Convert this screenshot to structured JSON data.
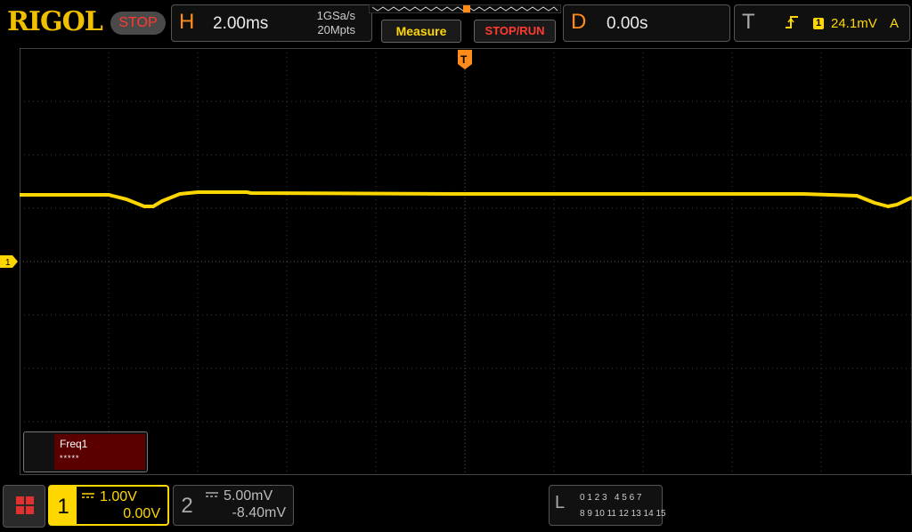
{
  "header": {
    "logo": "RIGOL",
    "run_state": "STOP",
    "horizontal": {
      "label": "H",
      "timebase": "2.00ms",
      "sample_rate": "1GSa/s",
      "memory_depth": "20Mpts"
    },
    "measure_label": "Measure",
    "stoprun_label": "STOP/RUN",
    "delay": {
      "label": "D",
      "value": "0.00s"
    },
    "trigger": {
      "label": "T",
      "source": "1",
      "level": "24.1mV",
      "mode": "A",
      "edge_icon": "rising-edge-icon"
    }
  },
  "screen": {
    "ch1_marker_label": "1",
    "trigger_marker_label": "T"
  },
  "measurement": {
    "name": "Freq1",
    "value": "*****"
  },
  "channels": {
    "ch1": {
      "number": "1",
      "scale": "1.00V",
      "offset": "0.00V",
      "color": "#ffd700"
    },
    "ch2": {
      "number": "2",
      "scale": "5.00mV",
      "offset": "-8.40mV",
      "color": "#aaaaaa"
    }
  },
  "logic": {
    "label": "L",
    "row1": "0 1 2 3   4 5 6 7",
    "row2": "8 9 10 11 12 13 14 15"
  },
  "colors": {
    "accent": "#ff8c1a",
    "trace": "#ffd700",
    "stop": "#ff3b30"
  }
}
